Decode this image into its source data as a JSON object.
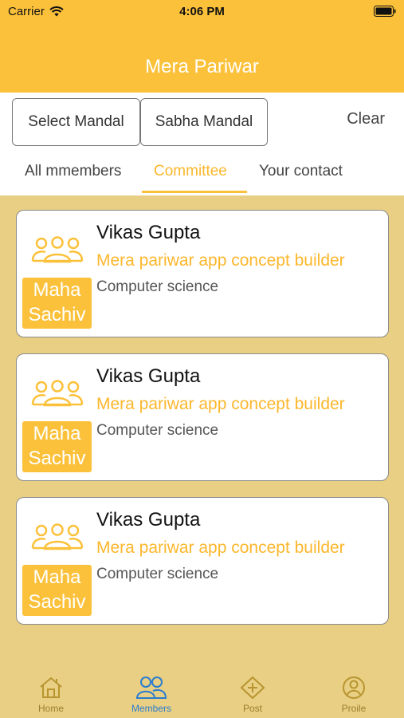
{
  "status_bar": {
    "carrier": "Carrier",
    "time": "4:06 PM"
  },
  "header": {
    "title": "Mera Pariwar"
  },
  "filters": {
    "select_mandal": "Select Mandal",
    "sabha_mandal": "Sabha Mandal",
    "clear": "Clear"
  },
  "tabs": [
    {
      "label": "All mmembers"
    },
    {
      "label": "Committee",
      "active": true
    },
    {
      "label": "Your contact"
    }
  ],
  "members": [
    {
      "name": "Vikas Gupta",
      "role": "Mera pariwar app concept builder",
      "department": "Computer science",
      "badge_line1": "Maha",
      "badge_line2": "Sachiv"
    },
    {
      "name": "Vikas Gupta",
      "role": "Mera pariwar app concept builder",
      "department": "Computer science",
      "badge_line1": "Maha",
      "badge_line2": "Sachiv"
    },
    {
      "name": "Vikas Gupta",
      "role": "Mera pariwar app concept builder",
      "department": "Computer science",
      "badge_line1": "Maha",
      "badge_line2": "Sachiv"
    }
  ],
  "bottom_nav": [
    {
      "label": "Home",
      "icon": "home-icon"
    },
    {
      "label": "Members",
      "icon": "members-icon",
      "active": true
    },
    {
      "label": "Post",
      "icon": "add-post-icon"
    },
    {
      "label": "Proile",
      "icon": "profile-icon"
    }
  ],
  "colors": {
    "accent": "#fcc13a",
    "background": "#e8cf84",
    "active_nav": "#2a7ccf"
  }
}
